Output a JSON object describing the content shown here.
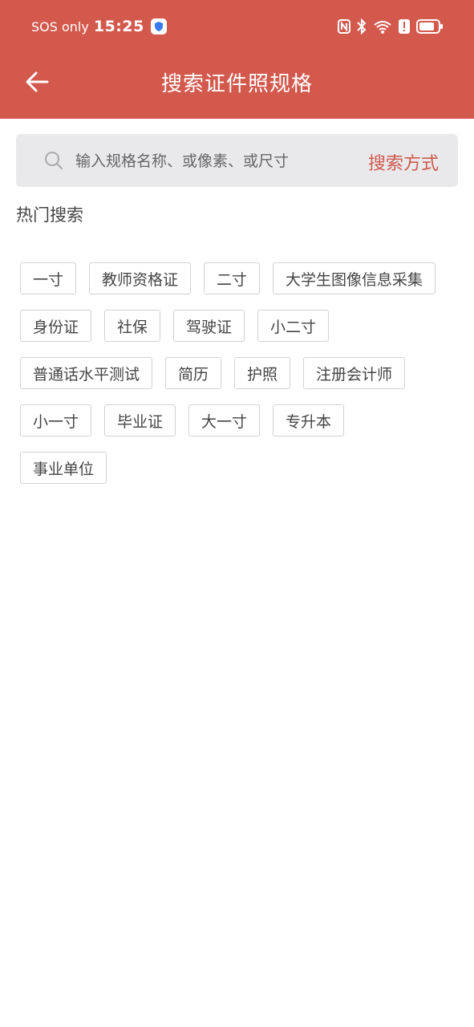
{
  "status_bar": {
    "carrier": "SOS only",
    "time": "15:25"
  },
  "header": {
    "title": "搜索证件照规格"
  },
  "search": {
    "placeholder": "输入规格名称、或像素、或尺寸",
    "value": "",
    "mode_label": "搜索方式"
  },
  "hot_search": {
    "title": "热门搜索",
    "rows": [
      [
        "一寸",
        "教师资格证",
        "二寸",
        "大学生图像信息采集"
      ],
      [
        "身份证",
        "社保",
        "驾驶证",
        "小二寸"
      ],
      [
        "普通话水平测试",
        "简历",
        "护照",
        "注册会计师"
      ],
      [
        "小一寸",
        "毕业证",
        "大一寸",
        "专升本"
      ],
      [
        "事业单位"
      ]
    ]
  },
  "colors": {
    "primary": "#d4594d",
    "accent_text": "#cf5a4c",
    "search_bg": "#e9e9ec"
  }
}
